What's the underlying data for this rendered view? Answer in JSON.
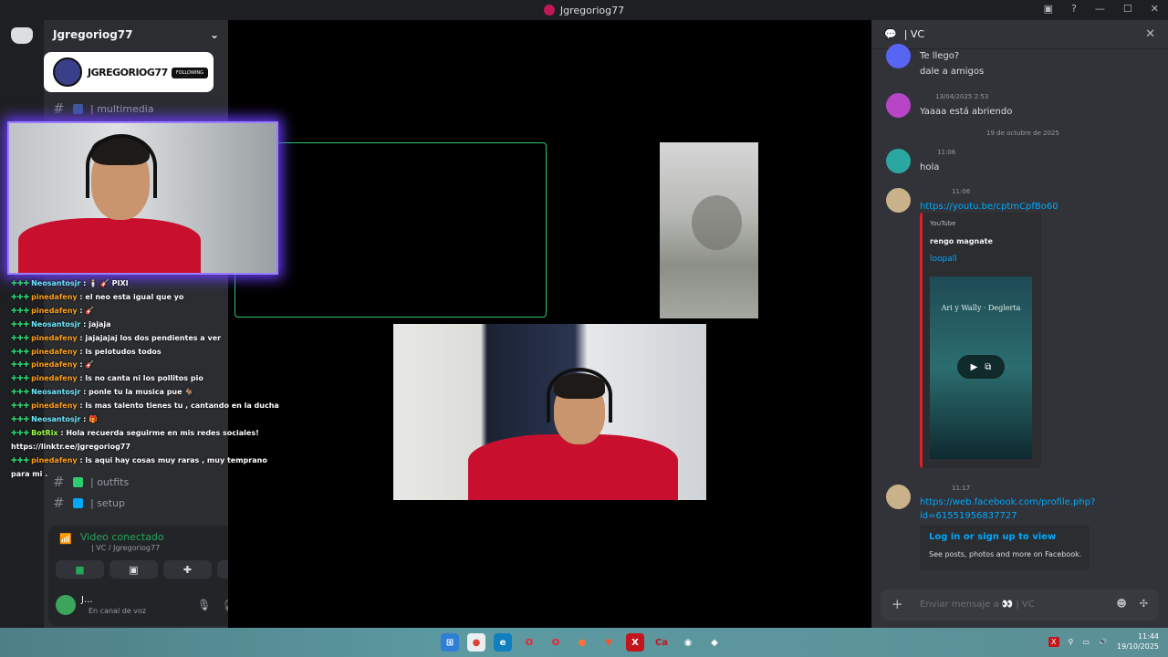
{
  "window": {
    "title": "Jgregoriog77"
  },
  "server": {
    "name": "Jgregoriog77"
  },
  "channels": [
    {
      "name": "| multimedia",
      "color": "#3b5998"
    },
    {
      "name": "| outfits",
      "color": "#2ecc71"
    },
    {
      "name": "| setup",
      "color": "#00a8fc"
    }
  ],
  "voice_panel": {
    "status": "Video conectado",
    "channel": "| VC / Jgregoriog77",
    "user_name": "J...",
    "user_status": "En canal de voz"
  },
  "overlay": {
    "banner_name": "JGREGORIOG77",
    "follow_label": "FOLLOWING",
    "chat": [
      {
        "user": "Neosantosjr",
        "text": " : 🕯️ 🎸 PIXI",
        "cls": "b"
      },
      {
        "user": "pinedafeny",
        "text": " : el neo esta igual que yo",
        "cls": ""
      },
      {
        "user": "pinedafeny",
        "text": " : 🎸",
        "cls": ""
      },
      {
        "user": "Neosantosjr",
        "text": " : jajaja",
        "cls": "b"
      },
      {
        "user": "pinedafeny",
        "text": " : jajajajaj los dos pendientes a ver",
        "cls": ""
      },
      {
        "user": "pinedafeny",
        "text": " : ls pelotudos todos",
        "cls": ""
      },
      {
        "user": "pinedafeny",
        "text": " : 🎸",
        "cls": ""
      },
      {
        "user": "pinedafeny",
        "text": " : ls no canta ni los pollitos pio",
        "cls": ""
      },
      {
        "user": "Neosantosjr",
        "text": " : ponle tu la musica pue 🐐",
        "cls": "b"
      },
      {
        "user": "pinedafeny",
        "text": " : ls mas talento tienes tu , cantando en la ducha",
        "cls": ""
      },
      {
        "user": "Neosantosjr",
        "text": " : 🎁",
        "cls": "b"
      },
      {
        "user": "BotRix",
        "text": " : Hola recuerda seguirme en mis redes sociales!",
        "cls": "g"
      },
      {
        "user": "",
        "text": "https://linktr.ee/jgregoriog77",
        "cls": ""
      },
      {
        "user": "pinedafeny",
        "text": " : ls aqui hay cosas muy raras , muy temprano para mi .",
        "cls": ""
      }
    ]
  },
  "right_panel": {
    "title": "| VC",
    "messages": [
      {
        "time": "",
        "lines": [
          "Te llego?",
          "dale a amigos"
        ],
        "avatar_color": "#5865f2"
      },
      {
        "time": "13/04/2025 2:53",
        "lines": [
          "Yaaaa está abriendo"
        ],
        "avatar_color": "#b845c6"
      },
      {
        "time": "11:06",
        "lines": [
          "hola"
        ],
        "avatar_color": "#2aa7a0"
      },
      {
        "time": "11:06",
        "lines": [
          "https://youtu.be/cptmCpfBo60"
        ],
        "avatar_color": "#c9b18a"
      },
      {
        "time": "11:17",
        "lines": [
          "https://web.facebook.com/profile.php?",
          "id=61551956837727"
        ],
        "avatar_color": "#c9b18a"
      }
    ],
    "date_separator": "19 de octubre de 2025",
    "youtube_embed": {
      "provider": "YouTube",
      "title": "rengo magnate",
      "link": "loopall",
      "thumb_title": "Ari y Wally · Deglerta"
    },
    "facebook_embed": {
      "title": "Log in or sign up to view",
      "desc": "See posts, photos and more on Facebook."
    },
    "composer_placeholder": "Enviar mensaje a 👀 | VC"
  },
  "taskbar": {
    "time": "11:44",
    "date": "19/10/2025"
  }
}
